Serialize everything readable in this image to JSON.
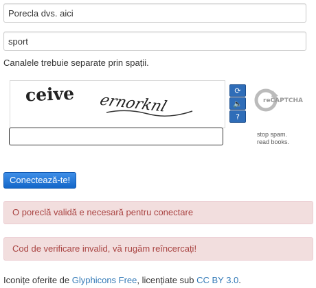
{
  "form": {
    "nickname_value": "Porecla dvs. aici",
    "channels_value": "sport",
    "channels_help": "Canalele trebuie separate prin spații."
  },
  "captcha": {
    "words": [
      "ceive",
      "ernorknl"
    ],
    "response_value": "",
    "logo_text": "reCAPTCHA",
    "tagline_line1": "stop spam.",
    "tagline_line2": "read books.",
    "buttons": [
      {
        "icon": "refresh-icon",
        "glyph": "⟳"
      },
      {
        "icon": "audio-icon",
        "glyph": "🔈"
      },
      {
        "icon": "help-icon",
        "glyph": "?"
      }
    ]
  },
  "connect_button_label": "Conectează-te!",
  "alerts": [
    "O poreclă validă e necesară pentru conectare",
    "Cod de verificare invalid, vă rugăm reîncercați!"
  ],
  "footer": {
    "prefix": "Iconițe oferite de ",
    "link1": "Glyphicons Free",
    "middle": ", licențiate sub ",
    "link2": "CC BY 3.0",
    "suffix": "."
  },
  "colors": {
    "primary": "#1366c8",
    "alert_bg": "#f2dede",
    "alert_text": "#a94442",
    "link": "#337ab7"
  }
}
